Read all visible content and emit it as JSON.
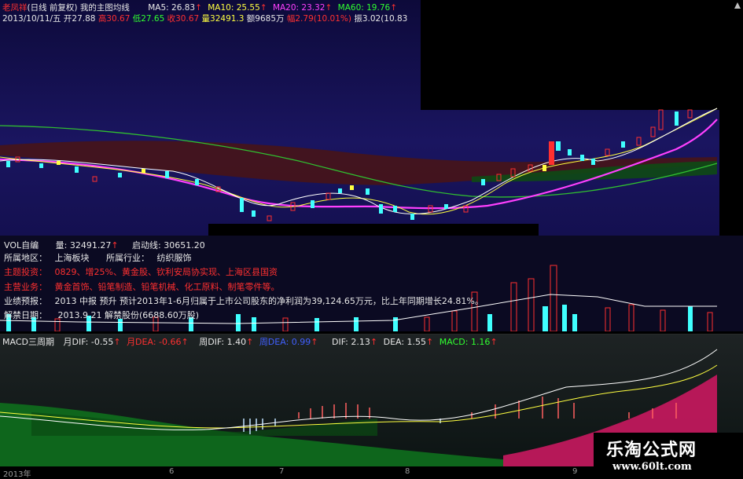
{
  "header": {
    "stock_name": "老凤祥",
    "mode": "(日线 前复权)",
    "indicator": "我的主图均线",
    "ma5": "MA5: 26.83",
    "ma10": "MA10: 25.55",
    "ma20": "MA20: 23.32",
    "ma60": "MA60: 19.76",
    "date": "2013/10/11/五",
    "open": "开27.88",
    "high": "高30.67",
    "low": "低27.65",
    "close": "收30.67",
    "volume": "量32491.3",
    "amount": "额9685万",
    "change": "幅2.79(10.01%)",
    "amplitude": "振3.02(10.83"
  },
  "volume_pane": {
    "label": "VOL自编",
    "volume": "量: 32491.27",
    "startline": "启动线: 30651.20"
  },
  "info": {
    "region_label": "所属地区：",
    "region_value": "上海板块",
    "industry_label": "所属行业：",
    "industry_value": "纺织服饰",
    "theme_label": "主题投资：",
    "theme_value": "0829、增25%、黄金股、钦利安局协实现、上海区县国资",
    "business_label": "主营业务：",
    "business_value": "黄金首饰、铅笔制造、铅笔机械、化工原料、制笔零件等。",
    "forecast_label": "业绩预报：",
    "forecast_value": "2013 中报 预升 预计2013年1-6月归属于上市公司股东的净利润为39,124.65万元，比上年同期增长24.81%。",
    "unlock_label": "解禁日期：",
    "unlock_value": "2013.9.21 解禁股份(6688.60万股)"
  },
  "macd_pane": {
    "label": "MACD三周期",
    "month_dif": "月DIF: -0.55",
    "month_dea": "月DEA: -0.66",
    "week_dif": "周DIF: 1.40",
    "week_dea": "周DEA: 0.99",
    "dif": "DIF: 2.13",
    "dea": "DEA: 1.55",
    "macd": "MACD: 1.16"
  },
  "axis": {
    "labels": [
      "2013年",
      "6",
      "7",
      "8",
      "9"
    ]
  },
  "logo": {
    "title": "乐淘公式网",
    "url": "www.60lt.com"
  },
  "colors": {
    "up": "#ff3030",
    "down": "#40ffff",
    "ma5": "#ffffff",
    "ma10": "#ffff40",
    "ma20": "#ff40ff",
    "ma60": "#30ff30"
  }
}
